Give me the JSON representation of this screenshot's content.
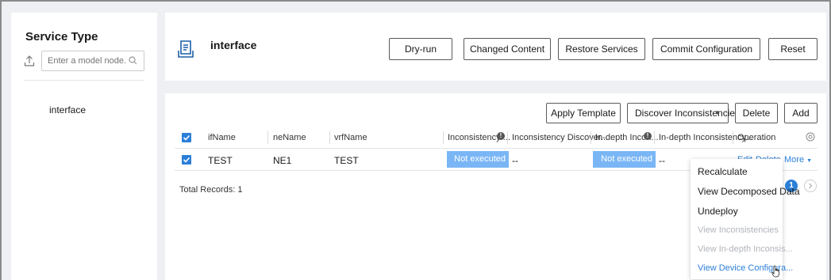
{
  "sidebar": {
    "title": "Service Type",
    "search_placeholder": "Enter a model node...",
    "tree_item": "interface"
  },
  "header": {
    "title": "interface",
    "buttons": {
      "dry_run": "Dry-run",
      "changed_content": "Changed Content",
      "restore_services": "Restore Services",
      "commit_configuration": "Commit Configuration",
      "reset": "Reset"
    }
  },
  "toolbar": {
    "apply_template": "Apply Template",
    "discover_inconsistencies": "Discover Inconsistencies",
    "delete": "Delete",
    "add": "Add"
  },
  "table": {
    "columns": {
      "ifName": "ifName",
      "neName": "neName",
      "vrfName": "vrfName",
      "inconsistency": "Inconsistency ...",
      "inconsistency_discover": "Inconsistency Discover...",
      "indepth_incon": "In-depth Incon...",
      "indepth_inconsistency": "In-depth Inconsistency...",
      "operation": "Operation"
    },
    "rows": [
      {
        "ifName": "TEST",
        "neName": "NE1",
        "vrfName": "TEST",
        "inconsistency": "Not executed",
        "inconsistency_discover": "--",
        "indepth_incon": "Not executed",
        "indepth_inconsistency": "--",
        "op_edit": "Edit",
        "op_delete": "Delete",
        "op_more": "More"
      }
    ],
    "total": "Total Records: 1"
  },
  "more_menu": {
    "items": [
      {
        "label": "Recalculate",
        "state": "enabled"
      },
      {
        "label": "View Decomposed Data",
        "state": "enabled"
      },
      {
        "label": "Undeploy",
        "state": "enabled"
      },
      {
        "label": "View Inconsistencies",
        "state": "disabled"
      },
      {
        "label": "View In-depth Inconsis...",
        "state": "disabled"
      },
      {
        "label": "View Device Configura...",
        "state": "hover"
      }
    ]
  },
  "pagination": {
    "current_page": "1"
  },
  "colors": {
    "accent": "#2b7fd8",
    "status_fill": "#7ab6f5",
    "background": "#eef0f3"
  }
}
